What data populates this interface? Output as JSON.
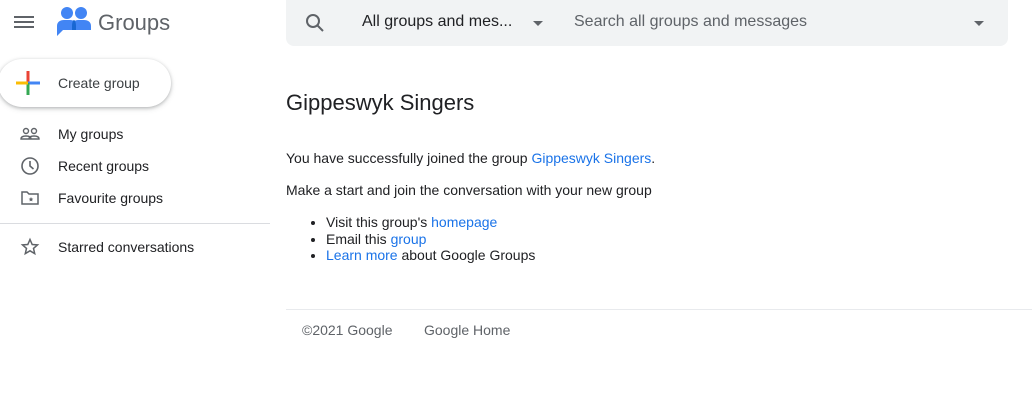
{
  "app": {
    "name": "Groups"
  },
  "sidebar": {
    "create_label": "Create group",
    "items": [
      {
        "label": "My groups",
        "icon": "people-icon"
      },
      {
        "label": "Recent groups",
        "icon": "clock-icon"
      },
      {
        "label": "Favourite groups",
        "icon": "folder-star-icon"
      }
    ],
    "starred": {
      "label": "Starred conversations",
      "icon": "star-icon"
    }
  },
  "search": {
    "scope": "All groups and mes...",
    "placeholder": "Search all groups and messages"
  },
  "main": {
    "title": "Gippeswyk Singers",
    "joined_prefix": "You have successfully joined the group ",
    "joined_link": "Gippeswyk Singers",
    "joined_suffix": ".",
    "intro": "Make a start and join the conversation with your new group",
    "list": [
      {
        "pre": "Visit this group's ",
        "link": "homepage",
        "post": ""
      },
      {
        "pre": "Email this ",
        "link": "group",
        "post": ""
      },
      {
        "pre": "",
        "link": "Learn more",
        "post": " about Google Groups"
      }
    ]
  },
  "footer": {
    "copyright": "©2021 Google",
    "home": "Google Home"
  }
}
